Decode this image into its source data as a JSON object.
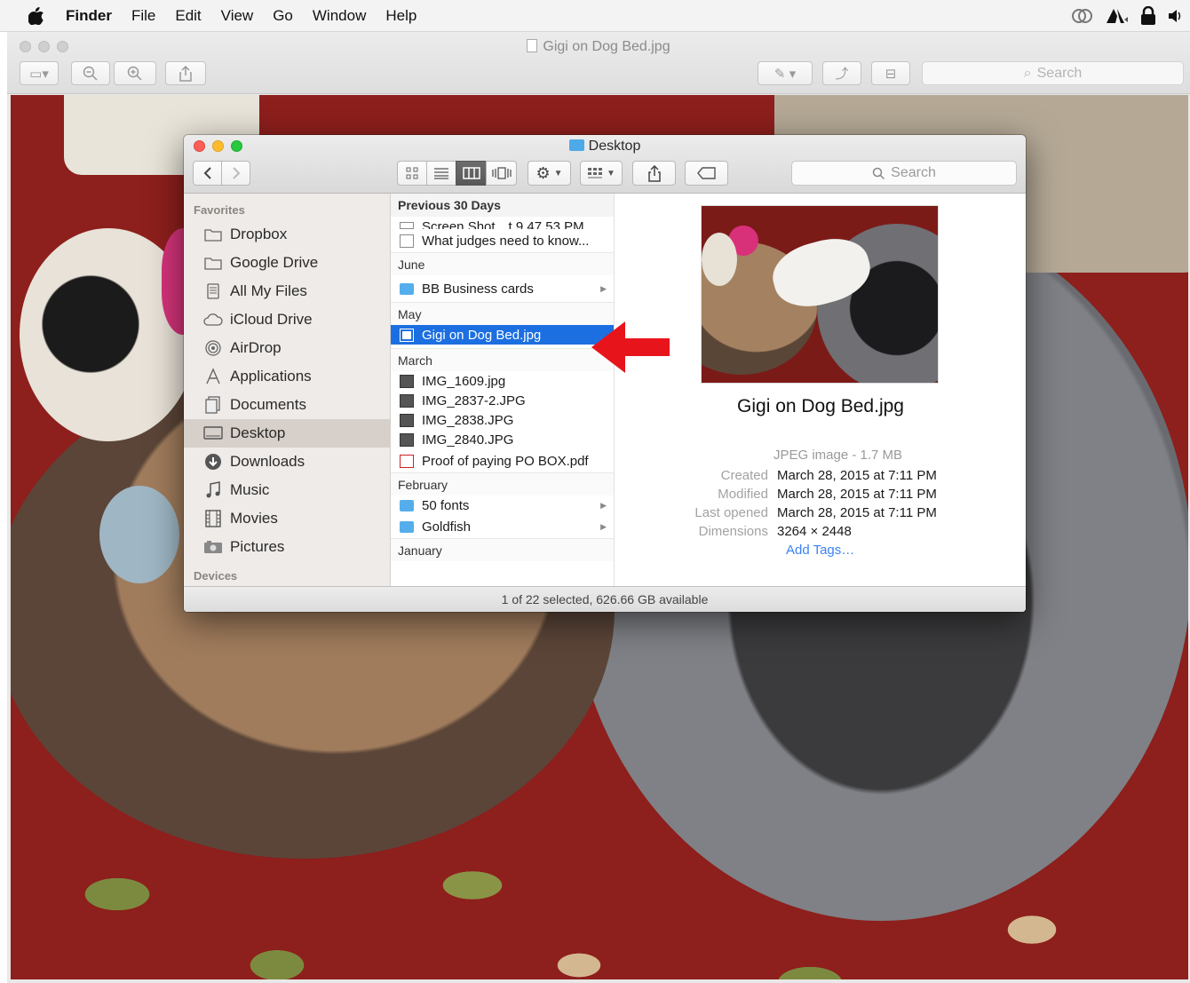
{
  "menubar": {
    "items": [
      "Finder",
      "File",
      "Edit",
      "View",
      "Go",
      "Window",
      "Help"
    ]
  },
  "preview_window": {
    "title": "Gigi on Dog Bed.jpg",
    "search_placeholder": "Search"
  },
  "finder": {
    "title": "Desktop",
    "search_placeholder": "Search",
    "sidebar": {
      "favorites_heading": "Favorites",
      "devices_heading": "Devices",
      "items": [
        {
          "label": "Dropbox",
          "icon": "folder-icon"
        },
        {
          "label": "Google Drive",
          "icon": "folder-icon"
        },
        {
          "label": "All My Files",
          "icon": "all-files-icon"
        },
        {
          "label": "iCloud Drive",
          "icon": "cloud-icon"
        },
        {
          "label": "AirDrop",
          "icon": "airdrop-icon"
        },
        {
          "label": "Applications",
          "icon": "applications-icon"
        },
        {
          "label": "Documents",
          "icon": "documents-icon"
        },
        {
          "label": "Desktop",
          "icon": "desktop-icon"
        },
        {
          "label": "Downloads",
          "icon": "downloads-icon"
        },
        {
          "label": "Music",
          "icon": "music-icon"
        },
        {
          "label": "Movies",
          "icon": "movies-icon"
        },
        {
          "label": "Pictures",
          "icon": "pictures-icon"
        }
      ],
      "selected": "Desktop"
    },
    "column": {
      "groups": {
        "previous30": "Previous 30 Days",
        "june": "June",
        "may": "May",
        "march": "March",
        "february": "February",
        "january": "January"
      },
      "files": {
        "screenshot": "Screen Shot…t 9.47.53 PM",
        "judges": "What judges need to know...",
        "bb_cards": "BB Business cards",
        "gigi": "Gigi on Dog Bed.jpg",
        "img1609": "IMG_1609.jpg",
        "img2837": "IMG_2837-2.JPG",
        "img2838": "IMG_2838.JPG",
        "img2840": "IMG_2840.JPG",
        "proof": "Proof of paying PO BOX.pdf",
        "fonts": "50 fonts",
        "goldfish": "Goldfish"
      }
    },
    "preview": {
      "name": "Gigi on Dog Bed.jpg",
      "kind": "JPEG image - 1.7 MB",
      "meta": {
        "created_label": "Created",
        "created": "March 28, 2015 at 7:11 PM",
        "modified_label": "Modified",
        "modified": "March 28, 2015 at 7:11 PM",
        "opened_label": "Last opened",
        "opened": "March 28, 2015 at 7:11 PM",
        "dimensions_label": "Dimensions",
        "dimensions": "3264 × 2448"
      },
      "tags_link": "Add Tags…"
    },
    "status": "1 of 22 selected, 626.66 GB available"
  },
  "colors": {
    "selection": "#1c6fe0",
    "annotation_arrow": "#e8141c",
    "folder": "#54aeec"
  }
}
